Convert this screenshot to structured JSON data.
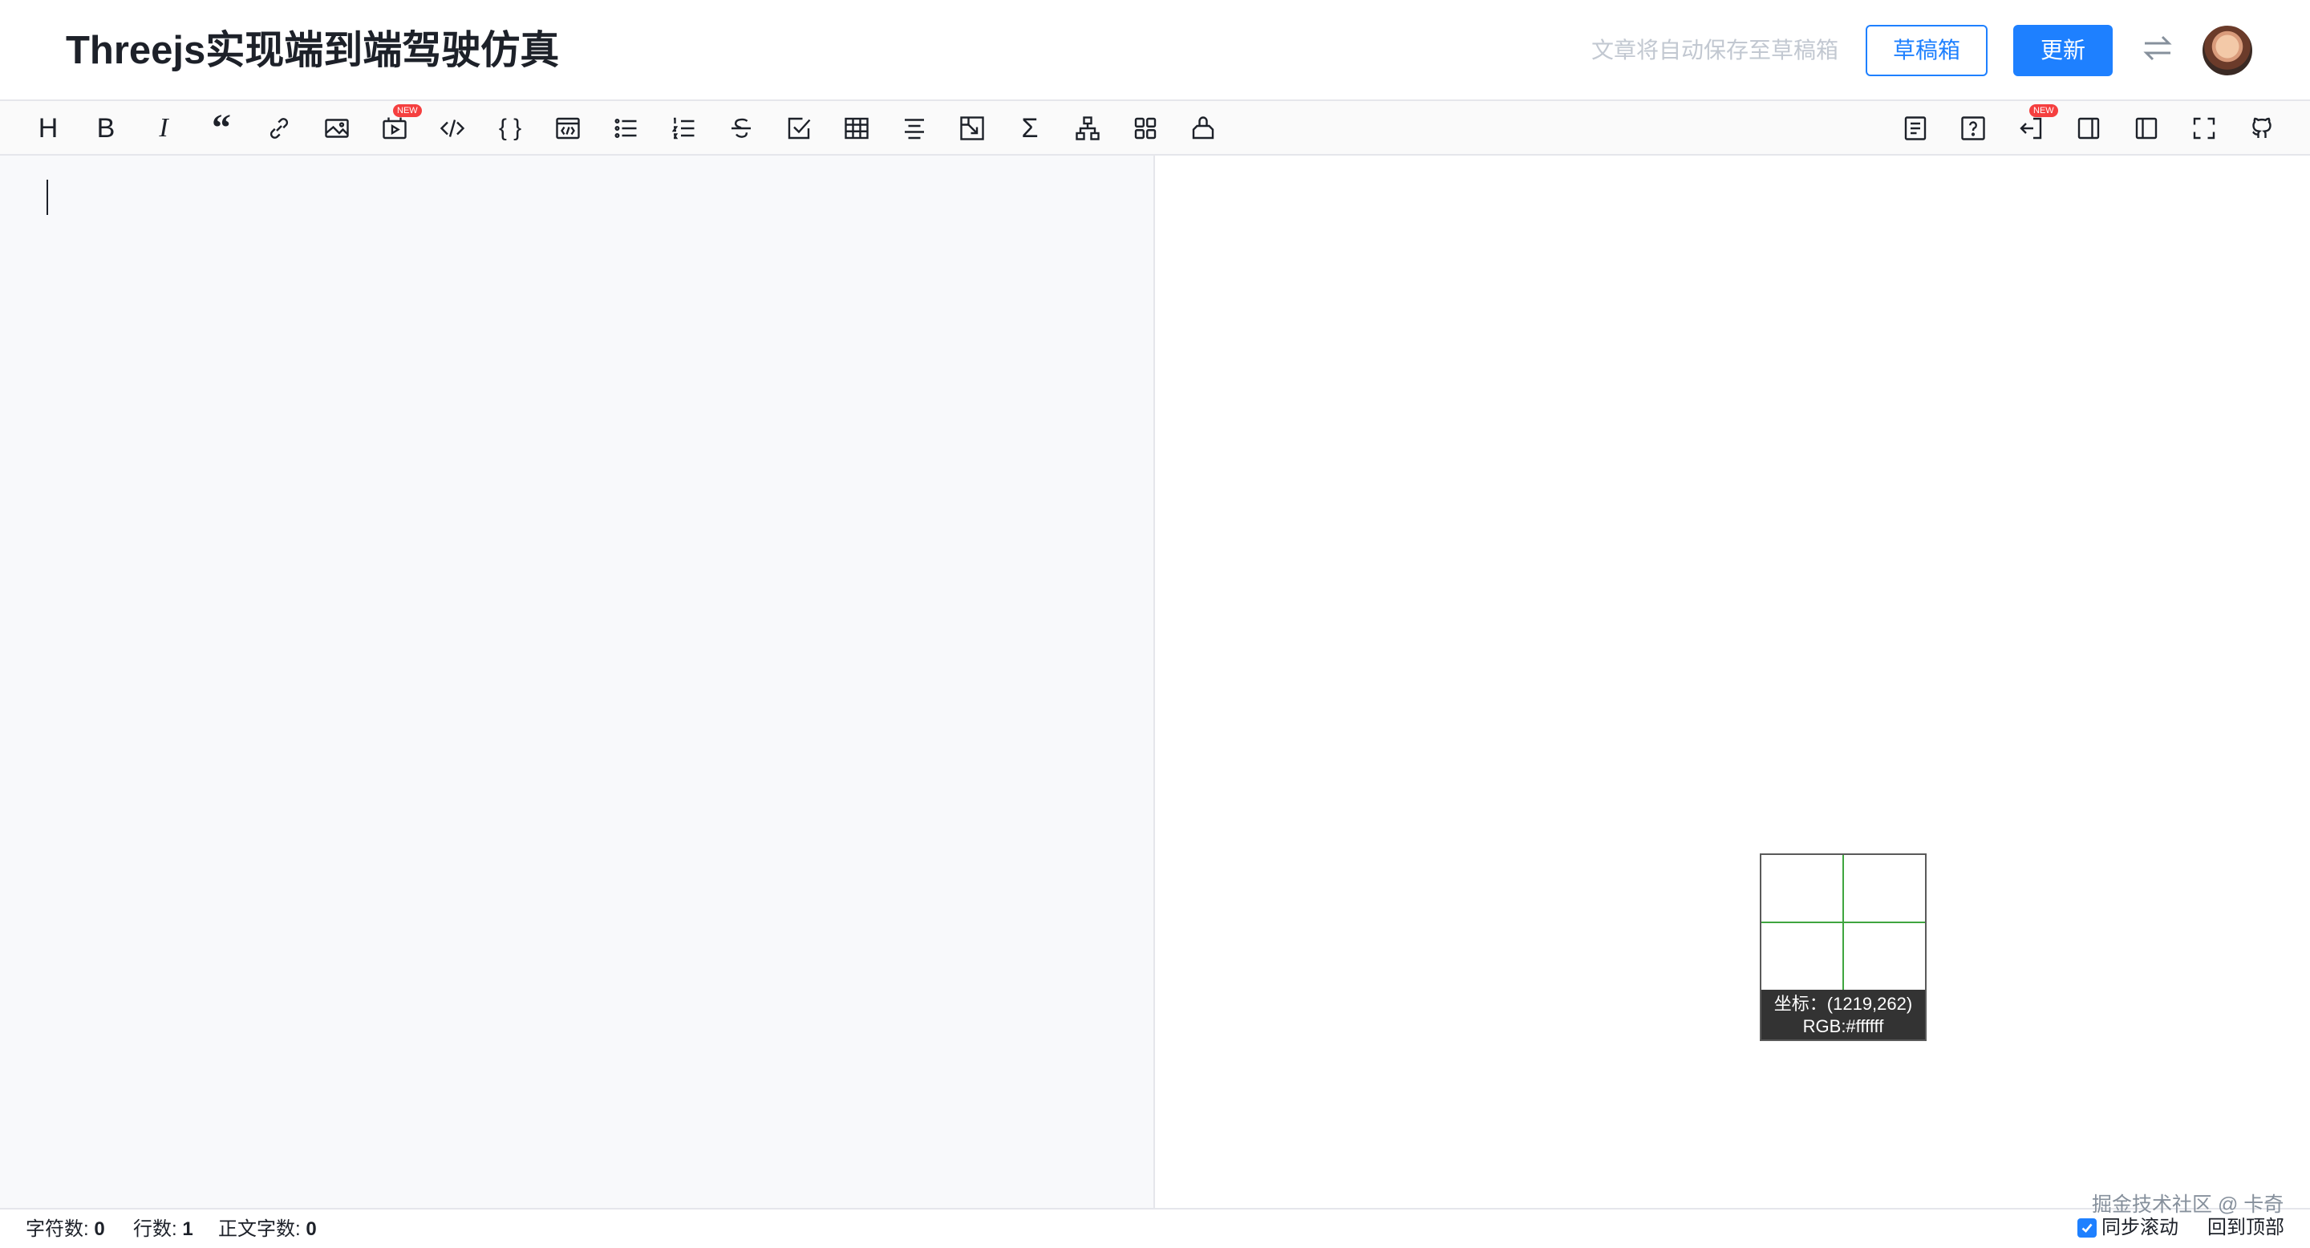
{
  "header": {
    "title": "Threejs实现端到端驾驶仿真",
    "autosave_tip": "文章将自动保存至草稿箱",
    "draft_button": "草稿箱",
    "update_button": "更新"
  },
  "toolbar": {
    "left_tools": [
      {
        "name": "heading",
        "icon": "heading-icon"
      },
      {
        "name": "bold",
        "icon": "bold-icon"
      },
      {
        "name": "italic",
        "icon": "italic-icon"
      },
      {
        "name": "quote",
        "icon": "quote-icon"
      },
      {
        "name": "link",
        "icon": "link-icon"
      },
      {
        "name": "image",
        "icon": "image-icon"
      },
      {
        "name": "video",
        "icon": "video-icon",
        "badge": "NEW"
      },
      {
        "name": "code",
        "icon": "code-icon"
      },
      {
        "name": "code-block",
        "icon": "braces-icon"
      },
      {
        "name": "html",
        "icon": "html-icon"
      },
      {
        "name": "unordered-list",
        "icon": "unordered-list-icon"
      },
      {
        "name": "ordered-list",
        "icon": "ordered-list-icon"
      },
      {
        "name": "strikethrough",
        "icon": "strikethrough-icon"
      },
      {
        "name": "task-list",
        "icon": "checkbox-icon"
      },
      {
        "name": "table",
        "icon": "table-icon"
      },
      {
        "name": "align",
        "icon": "align-center-icon"
      },
      {
        "name": "embed",
        "icon": "embed-icon"
      },
      {
        "name": "math",
        "icon": "sigma-icon"
      },
      {
        "name": "diagram",
        "icon": "diagram-icon"
      },
      {
        "name": "plugins",
        "icon": "grid-icon"
      },
      {
        "name": "theme",
        "icon": "theme-icon"
      }
    ],
    "right_tools": [
      {
        "name": "toc",
        "icon": "toc-icon"
      },
      {
        "name": "help",
        "icon": "help-icon"
      },
      {
        "name": "import",
        "icon": "import-icon",
        "badge": "NEW"
      },
      {
        "name": "preview-only",
        "icon": "preview-only-icon"
      },
      {
        "name": "editor-only",
        "icon": "editor-only-icon"
      },
      {
        "name": "fullscreen",
        "icon": "fullscreen-icon"
      },
      {
        "name": "github",
        "icon": "github-icon"
      }
    ],
    "heading_glyph": "H",
    "bold_glyph": "B",
    "italic_glyph": "I",
    "quote_glyph": "“",
    "braces_glyph": "{ }",
    "sigma_glyph": "Σ",
    "new_badge": "NEW"
  },
  "magnifier": {
    "coord_text": "坐标：(1219,262)",
    "rgb_text": "RGB:#ffffff"
  },
  "footer": {
    "char_count_label": "字符数:",
    "char_count": "0",
    "line_count_label": "行数:",
    "line_count": "1",
    "body_count_label": "正文字数:",
    "body_count": "0",
    "sync_scroll_label": "同步滚动",
    "sync_scroll_checked": true,
    "back_to_top": "回到顶部",
    "watermark": "掘金技术社区 @ 卡奇"
  },
  "colors": {
    "accent": "#1e80ff",
    "editor_bg": "#f8f9fb",
    "border": "#e5e6eb",
    "magnifier_cross": "#3fa53f"
  }
}
